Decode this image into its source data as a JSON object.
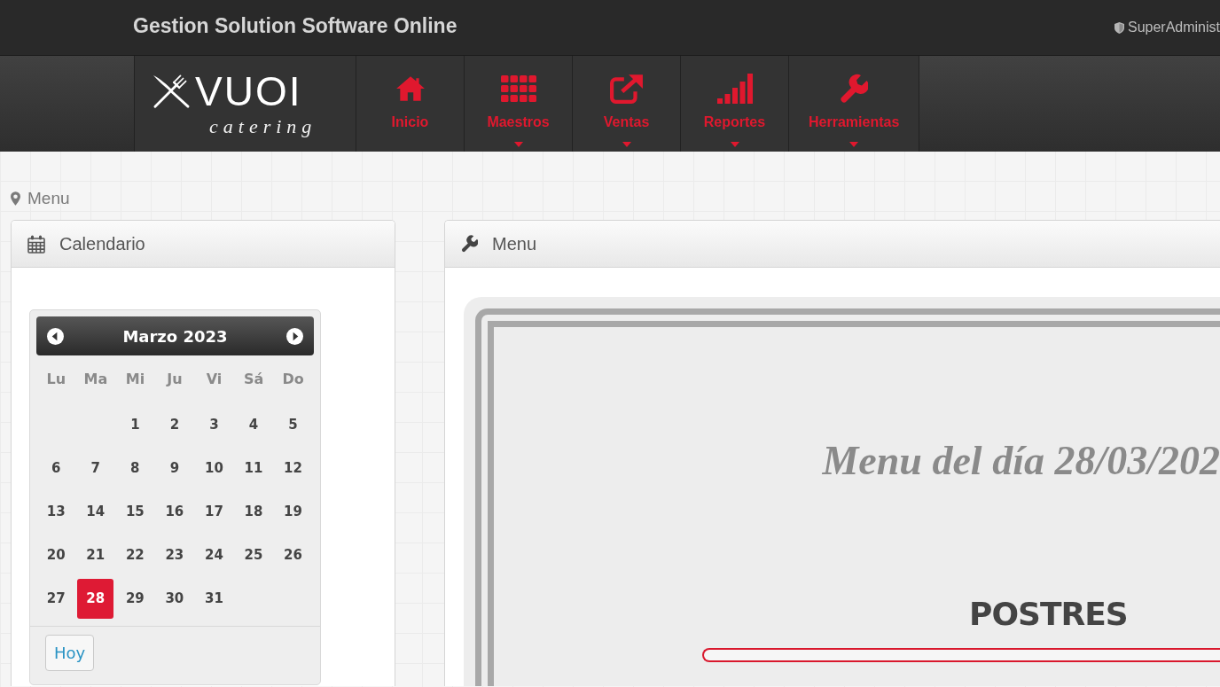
{
  "top_bar": {
    "title": "Gestion Solution Software Online",
    "user": "SuperAdminist"
  },
  "logo": {
    "name": "VUOI",
    "tagline": "catering"
  },
  "nav_items": [
    {
      "label": "Inicio",
      "dropdown": false
    },
    {
      "label": "Maestros",
      "dropdown": true
    },
    {
      "label": "Ventas",
      "dropdown": true
    },
    {
      "label": "Reportes",
      "dropdown": true
    },
    {
      "label": "Herramientas",
      "dropdown": true
    }
  ],
  "breadcrumb": {
    "label": "Menu"
  },
  "calendar_panel": {
    "title": "Calendario",
    "datepicker": {
      "month": "Marzo 2023",
      "weekdays": [
        "Lu",
        "Ma",
        "Mi",
        "Ju",
        "Vi",
        "Sá",
        "Do"
      ],
      "weeks": [
        {
          "days": [
            {
              "kind": "blank"
            },
            {
              "kind": "blank"
            },
            {
              "kind": "day",
              "label": "1",
              "selected": false
            },
            {
              "kind": "day",
              "label": "2",
              "selected": false
            },
            {
              "kind": "day",
              "label": "3",
              "selected": false
            },
            {
              "kind": "day",
              "label": "4",
              "selected": false
            },
            {
              "kind": "day",
              "label": "5",
              "selected": false
            }
          ]
        },
        {
          "days": [
            {
              "kind": "day",
              "label": "6",
              "selected": false
            },
            {
              "kind": "day",
              "label": "7",
              "selected": false
            },
            {
              "kind": "day",
              "label": "8",
              "selected": false
            },
            {
              "kind": "day",
              "label": "9",
              "selected": false
            },
            {
              "kind": "day",
              "label": "10",
              "selected": false
            },
            {
              "kind": "day",
              "label": "11",
              "selected": false
            },
            {
              "kind": "day",
              "label": "12",
              "selected": false
            }
          ]
        },
        {
          "days": [
            {
              "kind": "day",
              "label": "13",
              "selected": false
            },
            {
              "kind": "day",
              "label": "14",
              "selected": false
            },
            {
              "kind": "day",
              "label": "15",
              "selected": false
            },
            {
              "kind": "day",
              "label": "16",
              "selected": false
            },
            {
              "kind": "day",
              "label": "17",
              "selected": false
            },
            {
              "kind": "day",
              "label": "18",
              "selected": false
            },
            {
              "kind": "day",
              "label": "19",
              "selected": false
            }
          ]
        },
        {
          "days": [
            {
              "kind": "day",
              "label": "20",
              "selected": false
            },
            {
              "kind": "day",
              "label": "21",
              "selected": false
            },
            {
              "kind": "day",
              "label": "22",
              "selected": false
            },
            {
              "kind": "day",
              "label": "23",
              "selected": false
            },
            {
              "kind": "day",
              "label": "24",
              "selected": false
            },
            {
              "kind": "day",
              "label": "25",
              "selected": false
            },
            {
              "kind": "day",
              "label": "26",
              "selected": false
            }
          ]
        },
        {
          "days": [
            {
              "kind": "day",
              "label": "27",
              "selected": false
            },
            {
              "kind": "day",
              "label": "28",
              "selected": true
            },
            {
              "kind": "day",
              "label": "29",
              "selected": false
            },
            {
              "kind": "day",
              "label": "30",
              "selected": false
            },
            {
              "kind": "day",
              "label": "31",
              "selected": false
            }
          ]
        }
      ],
      "today_button": "Hoy"
    }
  },
  "menu_panel": {
    "title": "Menu",
    "heading": "Menu del día 28/03/202",
    "section": "POSTRES"
  }
}
